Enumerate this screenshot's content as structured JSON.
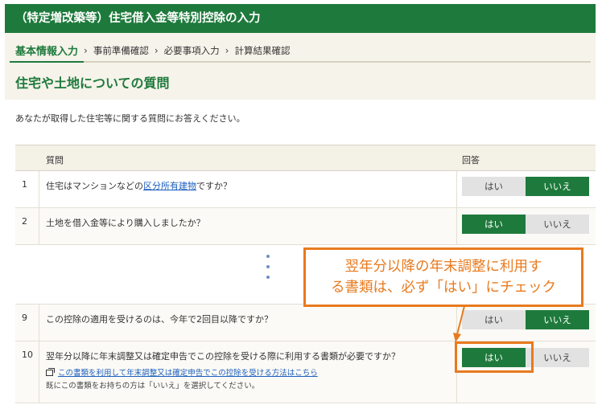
{
  "window": {
    "title": "（特定増改築等）住宅借入金等特別控除の入力"
  },
  "steps": {
    "items": [
      "基本情報入力",
      "事前準備確認",
      "必要事項入力",
      "計算結果確認"
    ],
    "separator": "›"
  },
  "page_title": "住宅や土地についての質問",
  "intro": "あなたが取得した住宅等に関する質問にお答えください。",
  "table": {
    "col_question": "質問",
    "col_answer": "回答",
    "rows": [
      {
        "num": "1",
        "q_before": "住宅はマンションなどの",
        "q_link": "区分所有建物",
        "q_after": "ですか？",
        "yes": "はい",
        "no": "いいえ",
        "selected": "no"
      },
      {
        "num": "2",
        "q": "土地を借入金等により購入しましたか？",
        "yes": "はい",
        "no": "いいえ",
        "selected": "yes"
      },
      {
        "num": "9",
        "q": "この控除の適用を受けるのは、今年で2回目以降ですか？",
        "yes": "はい",
        "no": "いいえ",
        "selected": "no"
      },
      {
        "num": "10",
        "q": "翌年分以降に年末調整又は確定申告でこの控除を受ける際に利用する書類が必要ですか？",
        "link": "この書類を利用して年末調整又は確定申告でこの控除を受ける方法はこちら",
        "note": "既にこの書類をお持ちの方は「いいえ」を選択してください。",
        "yes": "はい",
        "no": "いいえ",
        "selected": "yes"
      }
    ]
  },
  "callout": {
    "line1": "翌年分以降の年末調整に利用す",
    "line2": "る書類は、必ず「はい」にチェック"
  },
  "colors": {
    "brand_green": "#1e7a3c",
    "callout_orange": "#e87a1e",
    "link_blue": "#1d5fbd"
  }
}
